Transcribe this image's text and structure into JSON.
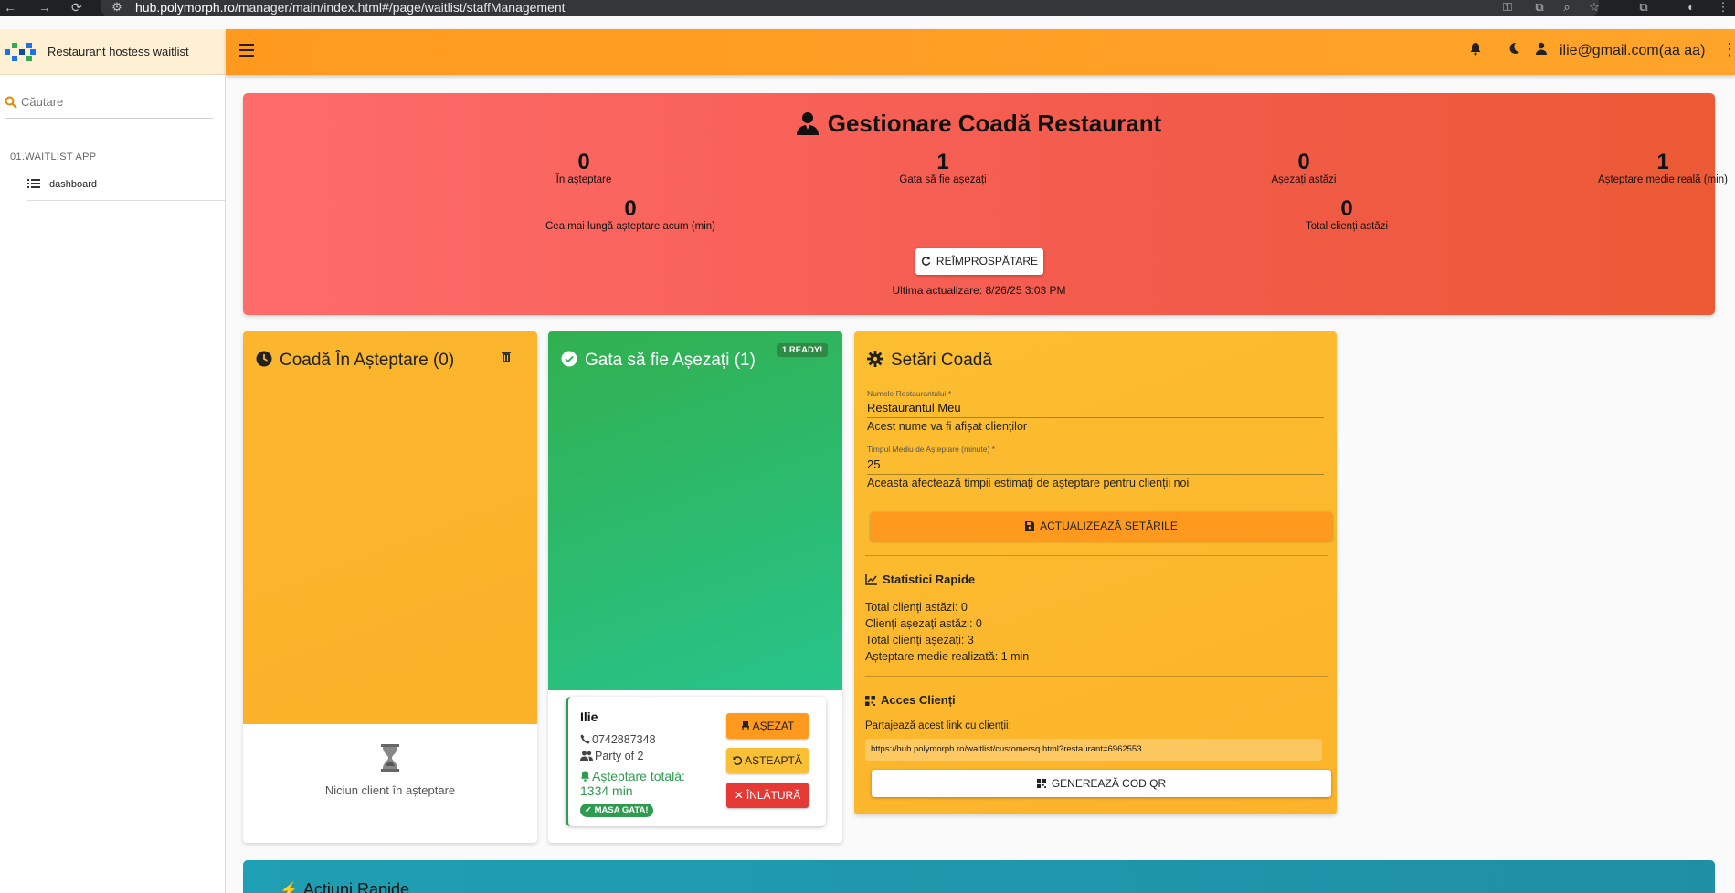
{
  "browser": {
    "url_host": "hub.polymorph.ro",
    "url_path": "/manager/main/index.html#/page/waitlist/staffManagement"
  },
  "app": {
    "title": "Restaurant hostess waitlist",
    "user": "ilie@gmail.com(aa aa)"
  },
  "sidebar": {
    "search_placeholder": "Căutare",
    "section": "01.WAITLIST APP",
    "items": [
      {
        "label": "dashboard",
        "icon": "list-icon"
      }
    ]
  },
  "hero": {
    "title": "Gestionare Coadă Restaurant",
    "stats": [
      {
        "value": "0",
        "label": "În așteptare"
      },
      {
        "value": "1",
        "label": "Gata să fie așezați"
      },
      {
        "value": "0",
        "label": "Așezați astăzi"
      },
      {
        "value": "1",
        "label": "Așteptare medie reală (min)"
      },
      {
        "value": "0",
        "label": "Cea mai lungă așteptare acum (min)"
      },
      {
        "value": "0",
        "label": "Total clienți astăzi"
      }
    ],
    "refresh_label": "REÎMPROSPĂTARE",
    "last_update": "Ultima actualizare: 8/26/25 3:03 PM"
  },
  "waiting": {
    "title": "Coadă În Așteptare (0)",
    "empty_text": "Niciun client în așteptare"
  },
  "ready": {
    "title": "Gata să fie Așezați (1)",
    "badge": "1 READY!",
    "guest": {
      "name": "Ilie",
      "phone": "0742887348",
      "party": "Party of 2",
      "wait": "Așteptare totală: 1334 min",
      "status": "MASA GATA!",
      "btn_seat": "AȘEZAT",
      "btn_wait": "AȘTEAPTĂ",
      "btn_remove": "ÎNLĂTURĂ"
    }
  },
  "settings": {
    "title": "Setări Coadă",
    "name_label": "Numele Restaurantului *",
    "name_value": "Restaurantul Meu",
    "name_help": "Acest nume va fi afișat clienților",
    "time_label": "Timpul Mediu de Așteptare (minute) *",
    "time_value": "25",
    "time_help": "Aceasta afectează timpii estimați de așteptare pentru clienții noi",
    "update_label": "ACTUALIZEAZĂ SETĂRILE",
    "stats_title": "Statistici Rapide",
    "stats": [
      "Total clienți astăzi: 0",
      "Clienți așezați astăzi: 0",
      "Total clienți așezați: 3",
      "Așteptare medie realizată: 1 min"
    ],
    "access_title": "Acces Clienți",
    "share_text": "Partajează acest link cu clienții:",
    "link": "https://hub.polymorph.ro/waitlist/customersq.html?restaurant=6962553",
    "qr_label": "GENEREAZĂ COD QR"
  },
  "quick": {
    "title": "Acțiuni Rapide"
  },
  "colors": {
    "header": "#ff9a1f",
    "hero": "#f35b4c",
    "waiting": "#fbb62e",
    "ready": "#2db462",
    "settings": "#fcbe31",
    "quick": "#1f9fb3"
  }
}
